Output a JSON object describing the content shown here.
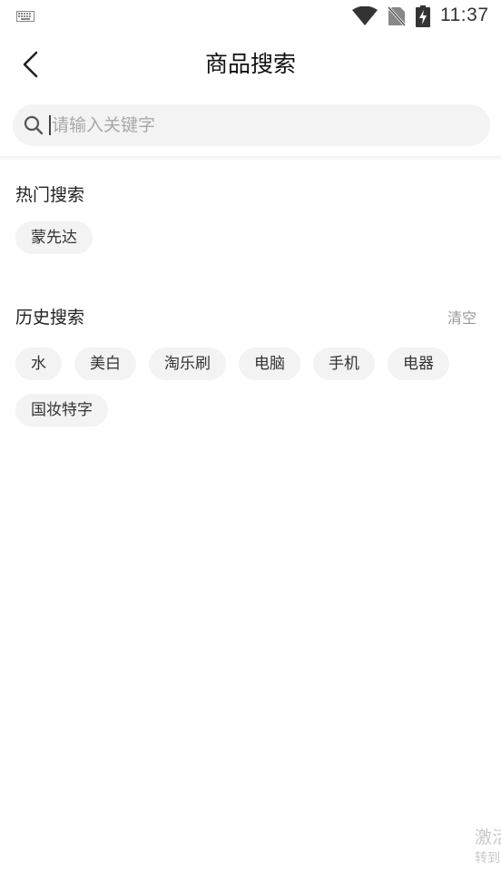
{
  "status_bar": {
    "time": "11:37",
    "icons": [
      "keyboard-icon",
      "wifi-icon",
      "no-sim-icon",
      "battery-charging-icon"
    ]
  },
  "header": {
    "title": "商品搜索",
    "back_icon": "chevron-left-icon"
  },
  "search": {
    "placeholder": "请输入关键字",
    "value": "",
    "icon": "search-icon"
  },
  "hot_search": {
    "title": "热门搜索",
    "tags": [
      "蒙先达"
    ]
  },
  "history_search": {
    "title": "历史搜索",
    "clear_label": "清空",
    "tags": [
      "水",
      "美白",
      "淘乐刷",
      "电脑",
      "手机",
      "电器",
      "国妆特字"
    ]
  },
  "watermark": {
    "title": "激活",
    "subtitle": "转到"
  },
  "colors": {
    "background": "#ffffff",
    "tag_background": "#f3f3f3",
    "search_background": "#f3f3f3",
    "muted_text": "#999999"
  }
}
